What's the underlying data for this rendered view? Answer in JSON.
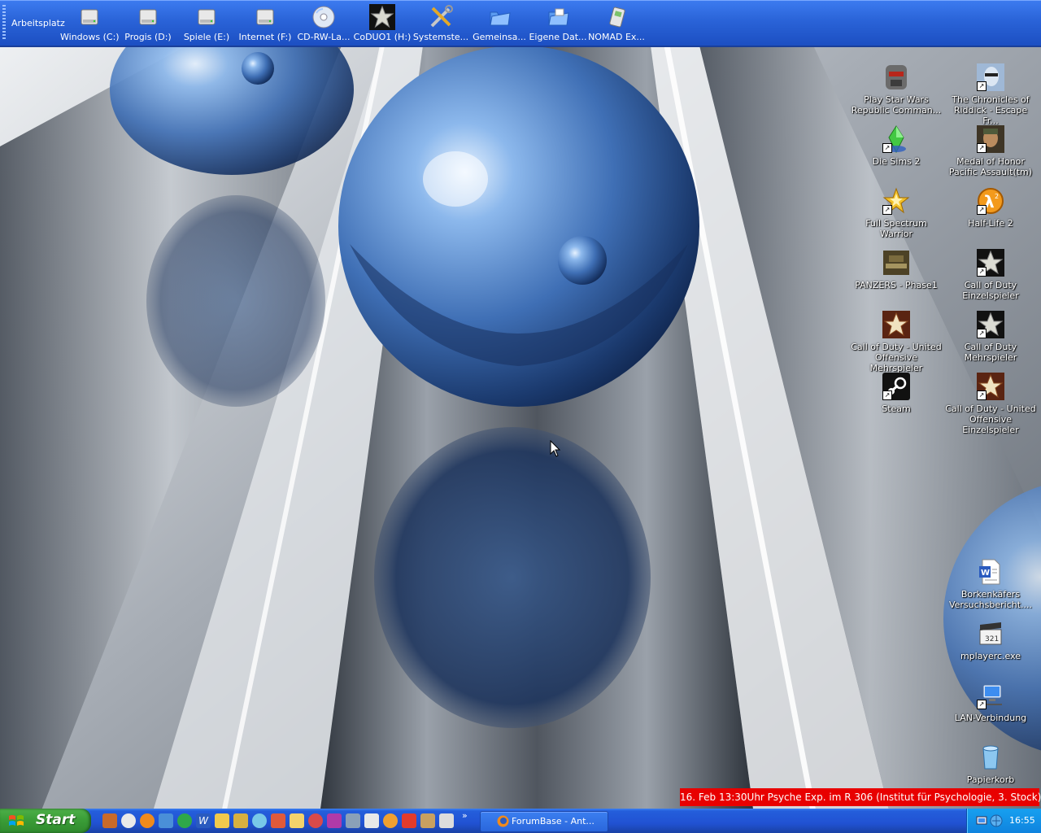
{
  "toolbar": {
    "title": "Arbeitsplatz",
    "items": [
      {
        "label": "Windows (C:)",
        "icon": "hard-drive-icon"
      },
      {
        "label": "Progis (D:)",
        "icon": "hard-drive-icon"
      },
      {
        "label": "Spiele (E:)",
        "icon": "hard-drive-icon"
      },
      {
        "label": "Internet (F:)",
        "icon": "hard-drive-icon"
      },
      {
        "label": "CD-RW-La...",
        "icon": "cd-drive-icon"
      },
      {
        "label": "CoDUO1 (H:)",
        "icon": "call-of-duty-star-icon"
      },
      {
        "label": "Systemste...",
        "icon": "tools-icon"
      },
      {
        "label": "Gemeinsa...",
        "icon": "shared-folder-icon"
      },
      {
        "label": "Eigene Dat...",
        "icon": "my-documents-icon"
      },
      {
        "label": "NOMAD Ex...",
        "icon": "mp3-player-icon"
      }
    ]
  },
  "desktop_icons": {
    "left_column": [
      {
        "label": "Play Star Wars Republic Comman...",
        "icon": "star-wars-icon"
      },
      {
        "label": "Die Sims 2",
        "icon": "sims-plumbob-icon"
      },
      {
        "label": "Full Spectrum Warrior",
        "icon": "gold-star-icon"
      },
      {
        "label": "PANZERS - Phase1",
        "icon": "panzers-icon"
      },
      {
        "label": "Call of Duty - United Offensive Mehrspieler",
        "icon": "call-of-duty-star-icon"
      },
      {
        "label": "Steam",
        "icon": "steam-icon"
      }
    ],
    "right_column": [
      {
        "label": "The Chronicles of Riddick - Escape Fr...",
        "icon": "riddick-icon"
      },
      {
        "label": "Medal of Honor Pacific Assault(tm)",
        "icon": "medal-of-honor-icon"
      },
      {
        "label": "Half-Life 2",
        "icon": "half-life-icon"
      },
      {
        "label": "Call of Duty Einzelspieler",
        "icon": "call-of-duty-star-icon"
      },
      {
        "label": "Call of Duty Mehrspieler",
        "icon": "call-of-duty-star-icon"
      },
      {
        "label": "Call of Duty - United Offensive Einzelspieler",
        "icon": "call-of-duty-star-icon"
      }
    ],
    "bottom_right": [
      {
        "label": "Borkenkäfers Versuchsbericht....",
        "icon": "word-document-icon"
      },
      {
        "label": "mplayerc.exe",
        "icon": "clapperboard-icon"
      },
      {
        "label": "LAN-Verbindung",
        "icon": "network-connection-icon"
      },
      {
        "label": "Papierkorb",
        "icon": "recycle-bin-icon"
      }
    ]
  },
  "notice": {
    "text": "16. Feb 13:30Uhr Psyche Exp. im R 306 (Institut für Psychologie, 3. Stock)"
  },
  "taskbar": {
    "start_label": "Start",
    "quick_launch": [
      "app-icon",
      "browser-icon",
      "firefox-icon",
      "app-icon",
      "globe-icon",
      "word-icon",
      "app-icon",
      "app-icon",
      "app-icon",
      "app-icon",
      "app-icon",
      "app-icon",
      "app-icon",
      "app-icon",
      "app-icon",
      "app-icon",
      "app-icon",
      "app-icon",
      "app-icon",
      "app-icon"
    ],
    "quick_launch_more": "»",
    "tasks": [
      {
        "label": "ForumBase - Ant...",
        "icon": "firefox-icon"
      }
    ],
    "clock": "16:55"
  },
  "colors": {
    "notice_bg": "#e80000",
    "taskbar_blue": "#245edb",
    "start_green": "#3c9f39",
    "tray_blue": "#0f83de"
  }
}
